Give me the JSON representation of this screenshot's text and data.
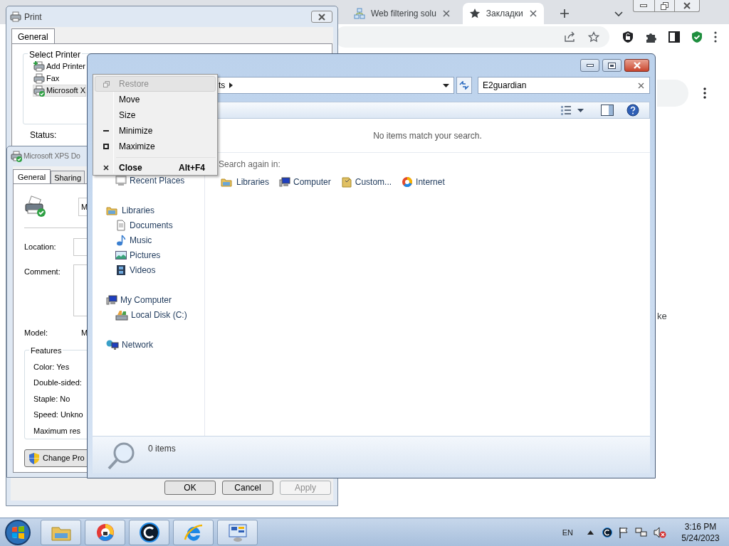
{
  "browser": {
    "tabs": [
      {
        "label": "Web filtering solu",
        "selected": false
      },
      {
        "label": "Закладки",
        "selected": true
      }
    ],
    "page_fragment": "ke"
  },
  "print_dialog": {
    "title": "Print",
    "tabs": [
      {
        "label": "General",
        "selected": true
      }
    ],
    "group_label": "Select Printer",
    "printers": [
      {
        "label": "Add Printer",
        "selected": false
      },
      {
        "label": "Fax",
        "selected": false
      },
      {
        "label": "Microsoft X",
        "selected": true
      }
    ],
    "status_label": "Status:",
    "buttons": [
      {
        "label": "OK",
        "disabled": false
      },
      {
        "label": "Cancel",
        "disabled": false
      },
      {
        "label": "Apply",
        "disabled": true
      }
    ]
  },
  "printer_properties": {
    "title": "Microsoft XPS Do",
    "tabs": [
      {
        "label": "General",
        "selected": true
      },
      {
        "label": "Sharing",
        "selected": false
      }
    ],
    "name_value": "M",
    "location_label": "Location:",
    "comment_label": "Comment:",
    "model_label": "Model:",
    "model_value": "M",
    "features_label": "Features",
    "features": [
      "Color: Yes",
      "Double-sided:",
      "Staple: No",
      "Speed: Unkno",
      "Maximum res"
    ],
    "change_button": "Change Pro"
  },
  "explorer": {
    "address_tail": "ts",
    "search_value": "E2guardian",
    "nav": [
      {
        "children": [
          {
            "label": "Recent Places"
          }
        ]
      },
      {
        "label": "Libraries",
        "children": [
          {
            "label": "Documents"
          },
          {
            "label": "Music"
          },
          {
            "label": "Pictures"
          },
          {
            "label": "Videos"
          }
        ]
      },
      {
        "label": "My Computer",
        "children": [
          {
            "label": "Local Disk (C:)"
          }
        ]
      },
      {
        "label": "Network"
      }
    ],
    "empty_message": "No items match your search.",
    "search_again_label": "Search again in:",
    "search_locations": [
      "Libraries",
      "Computer",
      "Custom...",
      "Internet"
    ],
    "details": "0 items"
  },
  "system_menu": [
    {
      "kind": "command",
      "label": "Restore",
      "selected": true,
      "disabled": true,
      "default": false
    },
    {
      "kind": "command",
      "label": "Move",
      "selected": false,
      "disabled": false,
      "default": false
    },
    {
      "kind": "command",
      "label": "Size",
      "selected": false,
      "disabled": false,
      "default": false
    },
    {
      "kind": "command",
      "label": "Minimize",
      "selected": false,
      "disabled": false,
      "default": false
    },
    {
      "kind": "command",
      "label": "Maximize",
      "selected": false,
      "disabled": false,
      "default": false
    },
    {
      "kind": "separator"
    },
    {
      "kind": "command",
      "label": "Close",
      "shortcut": "Alt+F4",
      "selected": false,
      "disabled": false,
      "default": true
    }
  ],
  "taskbar": {
    "language": "EN",
    "time": "3:16 PM",
    "date": "5/24/2023"
  }
}
